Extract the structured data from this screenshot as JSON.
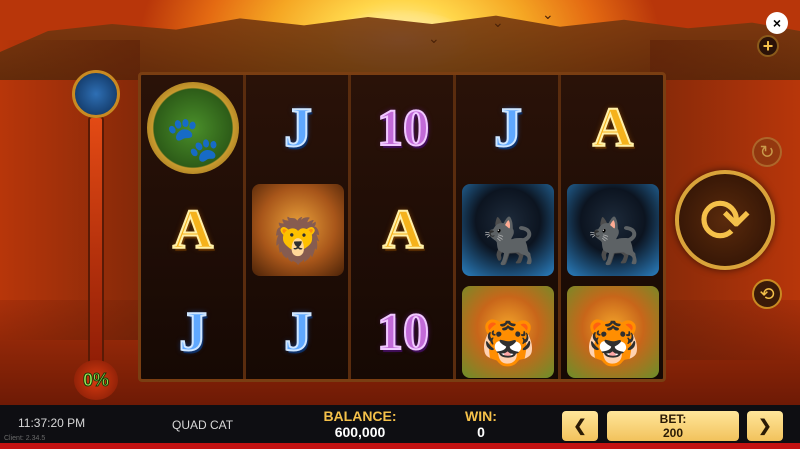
{
  "game": {
    "name": "QUAD CAT",
    "time": "11:37:20 PM",
    "client_version": "Client: 2.34.5"
  },
  "meter": {
    "percent": "0%",
    "icon": "panther-head-icon"
  },
  "reels": {
    "columns": [
      [
        {
          "kind": "paw",
          "label": "",
          "icon": "paw-scatter-icon"
        },
        {
          "kind": "A",
          "label": "A"
        },
        {
          "kind": "J",
          "label": "J"
        }
      ],
      [
        {
          "kind": "J",
          "label": "J"
        },
        {
          "kind": "lion",
          "label": "",
          "icon": "lion-icon"
        },
        {
          "kind": "J",
          "label": "J"
        }
      ],
      [
        {
          "kind": "T",
          "label": "10"
        },
        {
          "kind": "A",
          "label": "A"
        },
        {
          "kind": "T",
          "label": "10"
        }
      ],
      [
        {
          "kind": "J",
          "label": "J"
        },
        {
          "kind": "panther",
          "label": "",
          "icon": "panther-icon"
        },
        {
          "kind": "tiger",
          "label": "",
          "icon": "tiger-icon"
        }
      ],
      [
        {
          "kind": "A",
          "label": "A"
        },
        {
          "kind": "panther",
          "label": "",
          "icon": "panther-icon"
        },
        {
          "kind": "tiger",
          "label": "",
          "icon": "tiger-icon"
        }
      ]
    ]
  },
  "controls": {
    "close": "×",
    "plus": "+",
    "spin_glyph": "⟳",
    "auto_glyph": "↻",
    "turbo_glyph": "⟲"
  },
  "bar": {
    "balance_label": "BALANCE:",
    "balance_value": "600,000",
    "win_label": "WIN:",
    "win_value": "0",
    "bet_label": "BET:",
    "bet_value": "200",
    "bet_down": "❮",
    "bet_up": "❯"
  },
  "colors": {
    "accent": "#f5c14a",
    "bar_bg": "#0e0e12",
    "bar_line": "#c21212"
  }
}
